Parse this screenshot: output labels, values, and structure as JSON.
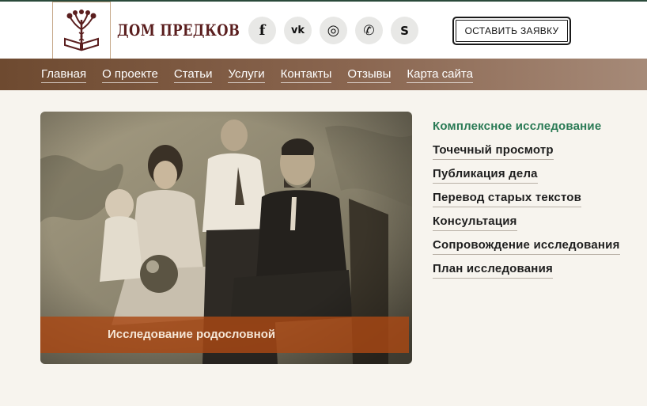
{
  "header": {
    "logo_text": "ДОМ ПРЕДКОВ",
    "cta_label": "ОСТАВИТЬ ЗАЯВКУ",
    "socials": [
      {
        "icon": "facebook-icon",
        "glyph": "f"
      },
      {
        "icon": "vk-icon",
        "glyph": "vk"
      },
      {
        "icon": "instagram-icon",
        "glyph": "◎"
      },
      {
        "icon": "whatsapp-icon",
        "glyph": "✆"
      },
      {
        "icon": "skype-icon",
        "glyph": "S"
      }
    ]
  },
  "nav": {
    "items": [
      "Главная",
      "О проекте",
      "Статьи",
      "Услуги",
      "Контакты",
      "Отзывы",
      "Карта сайта"
    ]
  },
  "hero": {
    "caption": "Исследование родословной"
  },
  "services": {
    "items": [
      "Комплексное исследование",
      "Точечный просмотр",
      "Публикация дела",
      "Перевод старых текстов",
      "Консультация",
      "Сопровождение исследования",
      "План исследования"
    ],
    "active_index": 0
  },
  "colors": {
    "accent_green": "#2a7a55",
    "logo_brown": "#5a1e1e",
    "nav_brown": "#6e4a30",
    "caption_orange": "#aa4814"
  }
}
